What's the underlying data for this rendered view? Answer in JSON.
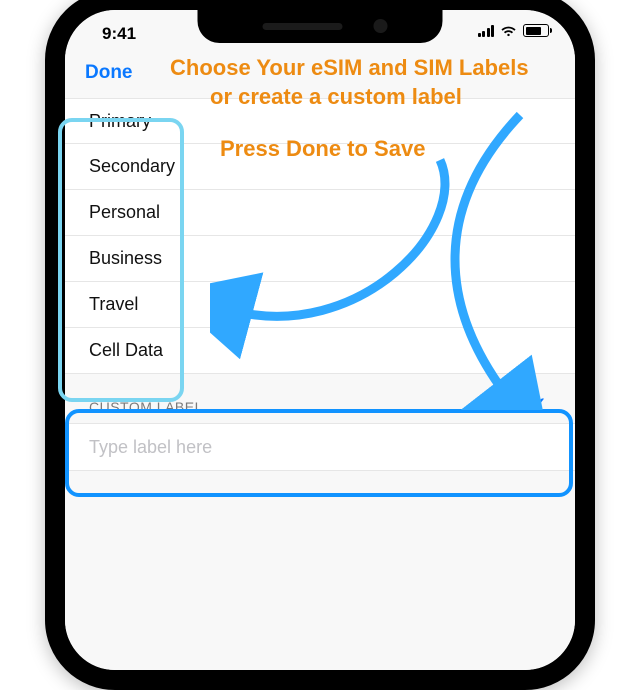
{
  "status": {
    "time": "9:41"
  },
  "nav": {
    "done": "Done"
  },
  "labels": [
    "Primary",
    "Secondary",
    "Personal",
    "Business",
    "Travel",
    "Cell Data"
  ],
  "custom": {
    "header": "CUSTOM LABEL",
    "placeholder": "Type label here",
    "value": ""
  },
  "annotations": {
    "line1": "Choose Your eSIM and SIM Labels",
    "line2": "or create a custom label",
    "press": "Press Done to Save"
  }
}
